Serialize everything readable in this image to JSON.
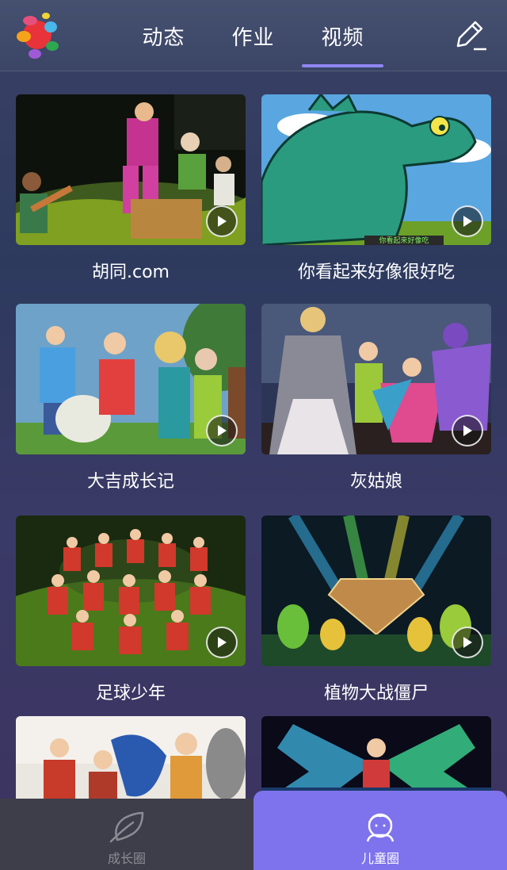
{
  "header": {
    "tabs": [
      {
        "label": "动态",
        "active": false
      },
      {
        "label": "作业",
        "active": false
      },
      {
        "label": "视频",
        "active": true
      }
    ],
    "active_color": "#8f86f2",
    "edit_icon": "edit-icon",
    "logo_icon": "app-logo-icon"
  },
  "videos": [
    {
      "title": "胡同.com"
    },
    {
      "title": "你看起来好像很好吃",
      "subtitle": "你看起来好像吃"
    },
    {
      "title": "大吉成长记"
    },
    {
      "title": "灰姑娘"
    },
    {
      "title": "足球少年"
    },
    {
      "title": "植物大战僵尸"
    },
    {
      "title": ""
    },
    {
      "title": ""
    }
  ],
  "bottom_nav": {
    "items": [
      {
        "label": "成长圈",
        "icon": "leaf-icon",
        "active": false
      },
      {
        "label": "儿童圈",
        "icon": "child-icon",
        "active": true
      }
    ],
    "active_color": "#7e73ec"
  }
}
